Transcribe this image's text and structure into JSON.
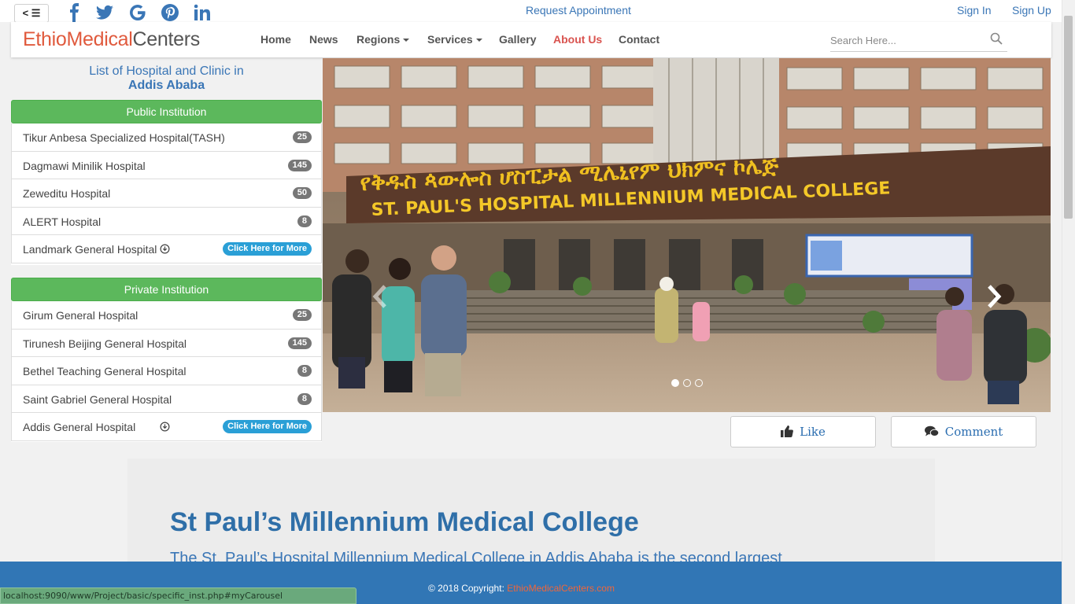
{
  "topbar": {
    "toggle_label": "< ☰",
    "social": [
      "facebook-icon",
      "twitter-icon",
      "google-icon",
      "pinterest-icon",
      "linkedin-icon"
    ],
    "request_appointment": "Request Appointment",
    "sign_in": "Sign In",
    "sign_up": "Sign Up"
  },
  "navbar": {
    "brand_part1": "EthioMedical",
    "brand_part2": "Centers",
    "items": [
      {
        "label": "Home"
      },
      {
        "label": "News"
      },
      {
        "label": "Regions"
      },
      {
        "label": "Services"
      },
      {
        "label": "Gallery"
      },
      {
        "label": "About Us"
      },
      {
        "label": "Contact"
      }
    ],
    "search_placeholder": "Search Here..."
  },
  "sidebar": {
    "title_line1": "List of Hospital and Clinic in",
    "title_city": "Addis Ababa",
    "public": {
      "heading": "Public Institution",
      "rows": [
        {
          "name": "Tikur Anbesa Specialized Hospital(TASH)",
          "count": "25"
        },
        {
          "name": "Dagmawi Minilik Hospital",
          "count": "145"
        },
        {
          "name": "Zeweditu Hospital",
          "count": "50"
        },
        {
          "name": "ALERT Hospital",
          "count": "8"
        },
        {
          "name": "Landmark General Hospital",
          "more": "Click Here for More"
        }
      ]
    },
    "private": {
      "heading": "Private Institution",
      "rows": [
        {
          "name": "Girum General Hospital",
          "count": "25"
        },
        {
          "name": "Tirunesh Beijing General Hospital",
          "count": "145"
        },
        {
          "name": "Bethel Teaching General Hospital",
          "count": "8"
        },
        {
          "name": "Saint Gabriel General Hospital",
          "count": "8"
        },
        {
          "name": "Addis General Hospital",
          "more": "Click Here for More"
        }
      ]
    }
  },
  "carousel": {
    "sign_amharic": "የቅዱስ ጳውሎስ ሆስፒታል ሚሌኒየም ህክምና ኮሌጅ",
    "sign_english": "ST. PAUL'S HOSPITAL MILLENNIUM MEDICAL COLLEGE",
    "slide_count": 3,
    "active_slide": 1
  },
  "actions": {
    "like_label": "Like",
    "comment_label": "Comment"
  },
  "article": {
    "title": "St Paul’s Millennium Medical College",
    "text": "The St. Paul’s Hospital Millennium Medical College in Addis Ababa is the second largest"
  },
  "footer": {
    "copyright": "© 2018 Copyright:",
    "site": "EthioMedicalCenters.com"
  },
  "status_bar": {
    "url": "localhost:9090/www/Project/basic/specific_inst.php#myCarousel"
  }
}
